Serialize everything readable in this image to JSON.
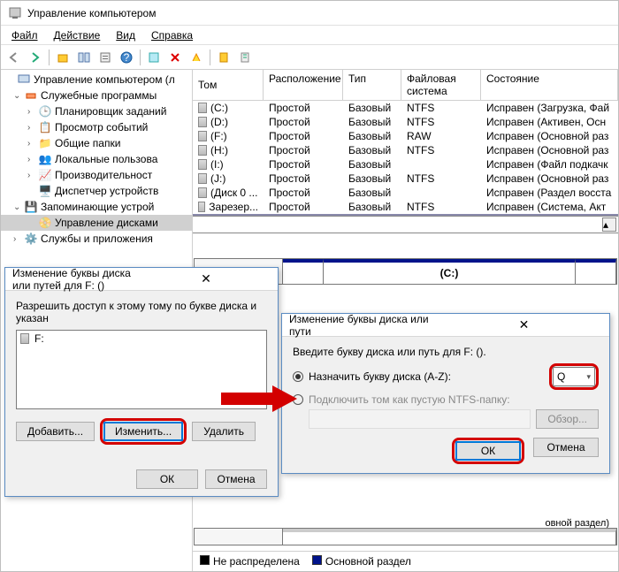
{
  "window": {
    "title": "Управление компьютером"
  },
  "menu": {
    "file": "Файл",
    "action": "Действие",
    "view": "Вид",
    "help": "Справка"
  },
  "tree": {
    "root": "Управление компьютером (л",
    "sys_tools": "Служебные программы",
    "task_sched": "Планировщик заданий",
    "event_viewer": "Просмотр событий",
    "shared_folders": "Общие папки",
    "local_users": "Локальные пользова",
    "performance": "Производительност",
    "dev_mgr": "Диспетчер устройств",
    "storage": "Запоминающие устрой",
    "disk_mgmt": "Управление дисками",
    "services": "Службы и приложения"
  },
  "vol_headers": {
    "volume": "Том",
    "layout": "Расположение",
    "type": "Тип",
    "fs": "Файловая система",
    "status": "Состояние"
  },
  "volumes": [
    {
      "name": "(C:)",
      "layout": "Простой",
      "type": "Базовый",
      "fs": "NTFS",
      "status": "Исправен (Загрузка, Фай"
    },
    {
      "name": "(D:)",
      "layout": "Простой",
      "type": "Базовый",
      "fs": "NTFS",
      "status": "Исправен (Активен, Осн"
    },
    {
      "name": "(F:)",
      "layout": "Простой",
      "type": "Базовый",
      "fs": "RAW",
      "status": "Исправен (Основной раз"
    },
    {
      "name": "(H:)",
      "layout": "Простой",
      "type": "Базовый",
      "fs": "NTFS",
      "status": "Исправен (Основной раз"
    },
    {
      "name": "(I:)",
      "layout": "Простой",
      "type": "Базовый",
      "fs": "",
      "status": "Исправен (Файл подкачк"
    },
    {
      "name": "(J:)",
      "layout": "Простой",
      "type": "Базовый",
      "fs": "NTFS",
      "status": "Исправен (Основной раз"
    },
    {
      "name": "(Диск 0 ...",
      "layout": "Простой",
      "type": "Базовый",
      "fs": "",
      "status": "Исправен (Раздел восста"
    },
    {
      "name": "Зарезер...",
      "layout": "Простой",
      "type": "Базовый",
      "fs": "NTFS",
      "status": "Исправен (Система, Акт"
    }
  ],
  "disk_map": {
    "seg_c": "(C:)",
    "partial_text": "овной раздел)"
  },
  "legend": {
    "unalloc": "Не распределена",
    "primary": "Основной раздел"
  },
  "dlg1": {
    "title": "Изменение буквы диска или путей для F: ()",
    "desc": "Разрешить доступ к этому тому по букве диска и указан",
    "list_f": "F:",
    "add": "Добавить...",
    "change": "Изменить...",
    "remove": "Удалить",
    "ok": "ОК",
    "cancel": "Отмена"
  },
  "dlg2": {
    "title": "Изменение буквы диска или пути",
    "desc": "Введите букву диска или путь для F: ().",
    "assign": "Назначить букву диска (A-Z):",
    "mount": "Подключить том как пустую NTFS-папку:",
    "letter": "Q",
    "browse": "Обзор...",
    "ok": "ОК",
    "cancel": "Отмена"
  }
}
